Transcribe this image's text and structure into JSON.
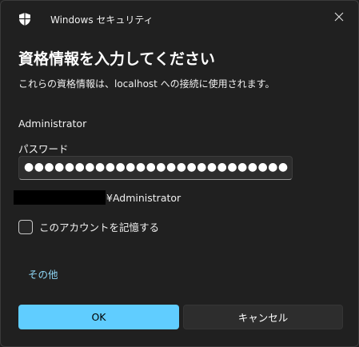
{
  "window": {
    "app_title": "Windows セキュリティ",
    "close_icon": "close-icon",
    "shield_icon": "shield-icon"
  },
  "dialog": {
    "heading": "資格情報を入力してください",
    "subtext": "これらの資格情報は、localhost への接続に使用されます。",
    "username": "Administrator",
    "password_label": "パスワード",
    "password_value": "●●●●●●●●●●●●●●●●●●●●●●●●●●",
    "domain_user": "¥Administrator",
    "remember_label": "このアカウントを記憶する",
    "remember_checked": false,
    "more_link": "その他"
  },
  "buttons": {
    "ok": "OK",
    "cancel": "キャンセル"
  },
  "colors": {
    "background": "#202020",
    "accent": "#60cdff",
    "link": "#8fd8f8"
  }
}
